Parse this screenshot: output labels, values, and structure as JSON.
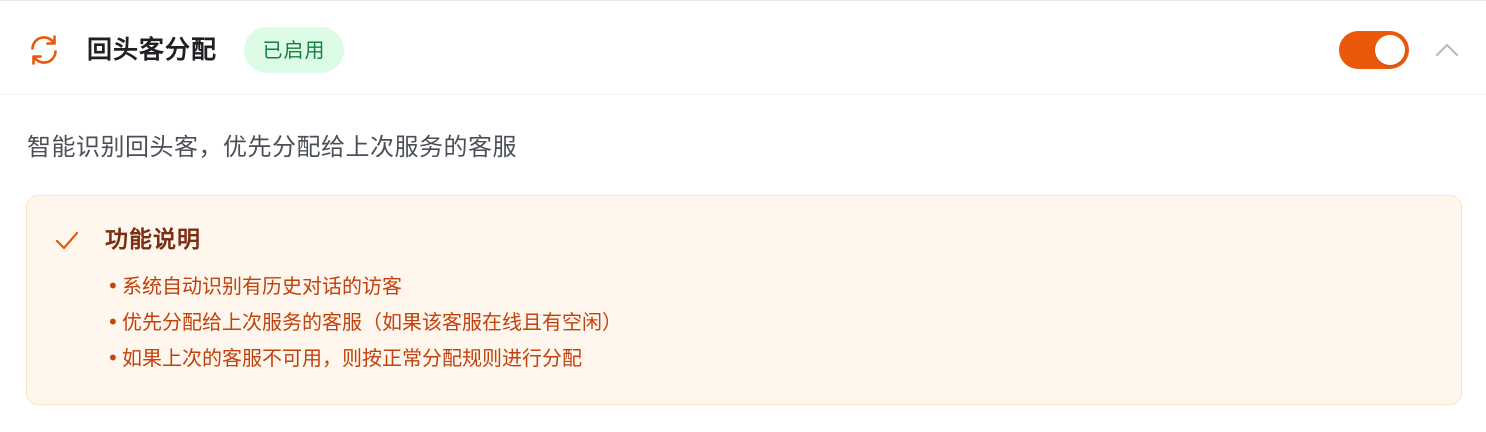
{
  "header": {
    "icon": "refresh-icon",
    "title": "回头客分配",
    "status_badge": "已启用",
    "toggle_on": true,
    "collapse_icon": "chevron-up-icon"
  },
  "description": "智能识别回头客，优先分配给上次服务的客服",
  "info_box": {
    "icon": "check-icon",
    "title": "功能说明",
    "items": [
      "系统自动识别有历史对话的访客",
      "优先分配给上次服务的客服（如果该客服在线且有空闲）",
      "如果上次的客服不可用，则按正常分配规则进行分配"
    ],
    "bullet": "•"
  },
  "colors": {
    "accent": "#ea580c",
    "badge_bg": "#dcfce7",
    "badge_text": "#15803d",
    "info_bg": "#fff7ed",
    "info_title": "#7c2d12",
    "info_text": "#c2410c"
  }
}
